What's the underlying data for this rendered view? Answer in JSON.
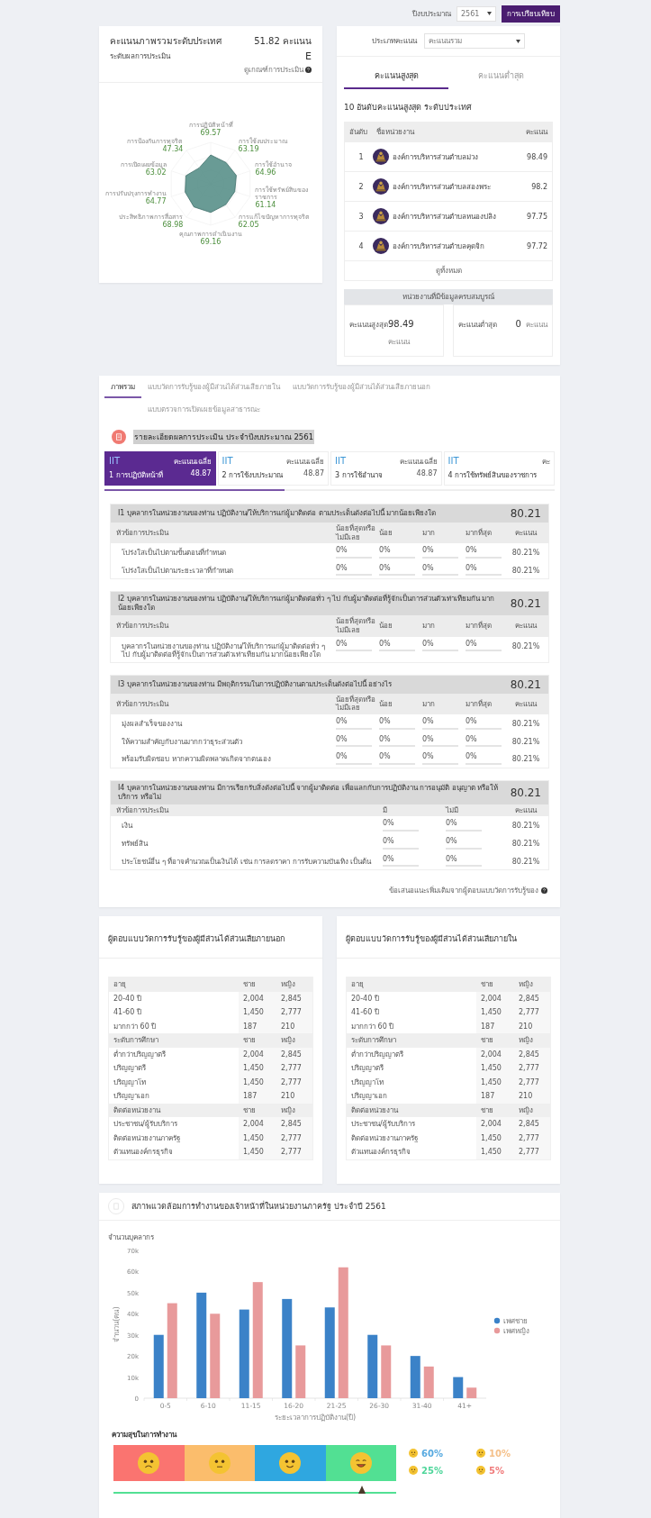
{
  "toolbar": {
    "year_label": "ปีงบประมาณ",
    "year": "2561",
    "compare_button": "การเปรียบเทียบ"
  },
  "overall": {
    "title": "คะแนนภาพรวมระดับประเทศ",
    "score": "51.82 คะแนน",
    "level_label": "ระดับผลการประเมิน",
    "grade": "E",
    "criteria_link": "ดูเกณฑ์การประเมิน",
    "radar": [
      {
        "label": "การปฏิบัติหน้าที่",
        "value": "69.57"
      },
      {
        "label": "การป้องกันการทุจริต",
        "value": "47.34"
      },
      {
        "label": "การใช้งบประมาณ",
        "value": "63.19"
      },
      {
        "label": "การเปิดเผยข้อมูล",
        "value": "63.02"
      },
      {
        "label": "การใช้อำนาจ",
        "value": "64.96"
      },
      {
        "label": "การปรับปรุงการทำงาน",
        "value": "64.77"
      },
      {
        "label": "การใช้ทรัพย์สินของราชการ",
        "value": "61.14"
      },
      {
        "label": "ประสิทธิภาพการสื่อสาร",
        "value": "68.98"
      },
      {
        "label": "การแก้ไขปัญหาการทุจริต",
        "value": "62.05"
      },
      {
        "label": "คุณภาพการดำเนินงาน",
        "value": "69.16"
      }
    ]
  },
  "ranking": {
    "type_label": "ประเภทคะแนน",
    "type_value": "คะแนนรวม",
    "tabs": [
      {
        "label": "คะแนนสูงสุด",
        "selected": true
      },
      {
        "label": "คะแนนต่ำสุด",
        "selected": false
      }
    ],
    "heading": "10 อันดับคะแนนสูงสุด ระดับประเทศ",
    "columns": [
      "อันดับ",
      "ชื่อหน่วยงาน",
      "คะแนน"
    ],
    "rows": [
      {
        "rank": "1",
        "name": "องค์การบริหารส่วนตำบลม่วง",
        "score": "98.49"
      },
      {
        "rank": "2",
        "name": "องค์การบริหารส่วนตำบลสองพระ",
        "score": "98.2"
      },
      {
        "rank": "3",
        "name": "องค์การบริหารส่วนตำบลหนองปลิง",
        "score": "97.75"
      },
      {
        "rank": "4",
        "name": "องค์การบริหารส่วนตำบลคุดจิก",
        "score": "97.72"
      }
    ],
    "view_all": "ดูทั้งหมด",
    "complete_title": "หน่วยงานที่มีข้อมูลครบสมบูรณ์",
    "summary": [
      {
        "label": "คะแนนสูงสุด",
        "value": "98.49",
        "unit": "คะแนน"
      },
      {
        "label": "คะแนนต่ำสุด",
        "value": "0",
        "unit": "คะแนน"
      }
    ]
  },
  "details": {
    "tabs": [
      {
        "label": "ภาพรวม",
        "selected": true
      },
      {
        "label": "แบบวัดการรับรู้ของผู้มีส่วนได้ส่วนเสียภายใน",
        "selected": false
      },
      {
        "label": "แบบวัดการรับรู้ของผู้มีส่วนได้ส่วนเสียภายนอก",
        "selected": false
      },
      {
        "label": "แบบตรวจการเปิดเผยข้อมูลสาธารณะ",
        "selected": false
      }
    ],
    "title": "รายละเอียดผลการประเมิน ประจำปีงบประมาณ 2561",
    "indicators": [
      {
        "tag": "IIT",
        "avg_label": "คะแนนเฉลี่ย",
        "name": "1 การปฏิบัติหน้าที่",
        "score": "48.87",
        "selected": true
      },
      {
        "tag": "IIT",
        "avg_label": "คะแนนเฉลี่ย",
        "name": "2 การใช้งบประมาณ",
        "score": "48.87",
        "selected": false
      },
      {
        "tag": "IIT",
        "avg_label": "คะแนนเฉลี่ย",
        "name": "3 การใช้อำนาจ",
        "score": "48.87",
        "selected": false
      },
      {
        "tag": "IIT",
        "avg_label": "คะ",
        "name": "4 การใช้ทรัพย์สินของราชการ",
        "selected": false
      }
    ],
    "questions": [
      {
        "title": "I1 บุคลากรในหน่วยงานของท่าน ปฏิบัติงาน/ให้บริการแก่ผู้มาติดต่อ ตามประเด็นดังต่อไปนี้ มากน้อยเพียงใด",
        "score": "80.21",
        "columns": [
          "หัวข้อการประเมิน",
          "น้อยที่สุดหรือไม่มีเลย",
          "น้อย",
          "มาก",
          "มากที่สุด",
          "คะแนน"
        ],
        "rows": [
          {
            "topic": "โปร่งใสเป็นไปตามขั้นตอนที่กำหนด",
            "answers": [
              {
                "text": "0%",
                "level": 0
              },
              {
                "text": "0%",
                "level": 0
              },
              {
                "text": "0%",
                "level": 0
              },
              {
                "text": "0%",
                "level": 0
              }
            ],
            "score": "80.21%"
          },
          {
            "topic": "โปร่งใสเป็นไปตามระยะเวลาที่กำหนด",
            "answers": [
              {
                "text": "0%",
                "level": 0
              },
              {
                "text": "0%",
                "level": 0
              },
              {
                "text": "0%",
                "level": 0
              },
              {
                "text": "0%",
                "level": 0
              }
            ],
            "score": "80.21%"
          }
        ]
      },
      {
        "title": "I2 บุคลากรในหน่วยงานของท่าน ปฏิบัติงาน/ให้บริการแก่ผู้มาติดต่อทั่ว ๆ ไป กับผู้มาติดต่อที่รู้จักเป็นการส่วนตัวเท่าเทียมกัน มากน้อยเพียงใด",
        "score": "80.21",
        "columns": [
          "หัวข้อการประเมิน",
          "น้อยที่สุดหรือไม่มีเลย",
          "น้อย",
          "มาก",
          "มากที่สุด",
          "คะแนน"
        ],
        "rows": [
          {
            "topic": "บุคลากรในหน่วยงานของท่าน ปฏิบัติงาน/ให้บริการแก่ผู้มาติดต่อทั่ว ๆ ไป กับผู้มาติดต่อที่รู้จักเป็นการส่วนตัวเท่าเทียมกัน มากน้อยเพียงใด",
            "answers": [
              {
                "text": "0%",
                "level": 0
              },
              {
                "text": "0%",
                "level": 0
              },
              {
                "text": "0%",
                "level": 0
              },
              {
                "text": "0%",
                "level": 0
              }
            ],
            "score": "80.21%"
          }
        ]
      },
      {
        "title": "I3 บุคลากรในหน่วยงานของท่าน มีพฤติกรรมในการปฏิบัติงานตามประเด็นดังต่อไปนี้ อย่างไร",
        "score": "80.21",
        "columns": [
          "หัวข้อการประเมิน",
          "น้อยที่สุดหรือไม่มีเลย",
          "น้อย",
          "มาก",
          "มากที่สุด",
          "คะแนน"
        ],
        "rows": [
          {
            "topic": "มุ่งผลสำเร็จของงาน",
            "answers": [
              {
                "text": "0%",
                "level": 0
              },
              {
                "text": "0%",
                "level": 0
              },
              {
                "text": "0%",
                "level": 0
              },
              {
                "text": "0%",
                "level": 0
              }
            ],
            "score": "80.21%"
          },
          {
            "topic": "ให้ความสำคัญกับงานมากกว่าธุระส่วนตัว",
            "answers": [
              {
                "text": "0%",
                "level": 0
              },
              {
                "text": "0%",
                "level": 0
              },
              {
                "text": "0%",
                "level": 0
              },
              {
                "text": "0%",
                "level": 0
              }
            ],
            "score": "80.21%"
          },
          {
            "topic": "พร้อมรับผิดชอบ หากความผิดพลาดเกิดจากตนเอง",
            "answers": [
              {
                "text": "0%",
                "level": 0
              },
              {
                "text": "0%",
                "level": 0
              },
              {
                "text": "0%",
                "level": 0
              },
              {
                "text": "0%",
                "level": 0
              }
            ],
            "score": "80.21%"
          }
        ]
      },
      {
        "title": "I4 บุคลากรในหน่วยงานของท่าน มีการเรียกรับสิ่งดังต่อไปนี้ จากผู้มาติดต่อ เพื่อแลกกับการปฏิบัติงาน การอนุมัติ อนุญาต หรือให้บริการ หรือไม่",
        "score": "80.21",
        "columns": [
          "หัวข้อการประเมิน",
          "มี",
          "ไม่มี",
          "คะแนน"
        ],
        "rows": [
          {
            "topic": "เงิน",
            "answers": [
              {
                "text": "0%",
                "level": 0
              },
              {
                "text": "0%",
                "level": 0
              }
            ],
            "score": "80.21%"
          },
          {
            "topic": "ทรัพย์สิน",
            "answers": [
              {
                "text": "0%",
                "level": 0
              },
              {
                "text": "0%",
                "level": 0
              }
            ],
            "score": "80.21%"
          },
          {
            "topic": "ประโยชน์อื่น ๆ ที่อาจคำนวณเป็นเงินได้ เช่น การลดราคา การรับความบันเทิง เป็นต้น",
            "answers": [
              {
                "text": "0%",
                "level": 0
              },
              {
                "text": "0%",
                "level": 0
              }
            ],
            "score": "80.21%"
          }
        ]
      }
    ],
    "footnote": "ข้อเสนอแนะเพิ่มเติมจากผู้ตอบแบบวัดการรับรู้ของ"
  },
  "respondents": [
    {
      "title": "ผู้ตอบแบบวัดการรับรู้ของผู้มีส่วนได้ส่วนเสียภายนอก",
      "groups": [
        {
          "heading": [
            "อายุ",
            "ชาย",
            "หญิง"
          ],
          "rows": [
            [
              "20-40 ปี",
              "2,004",
              "2,845"
            ],
            [
              "41-60 ปี",
              "1,450",
              "2,777"
            ],
            [
              "มากกว่า 60 ปี",
              "187",
              "210"
            ]
          ]
        },
        {
          "heading": [
            "ระดับการศึกษา",
            "ชาย",
            "หญิง"
          ],
          "rows": [
            [
              "ต่ำกว่าปริญญาตรี",
              "2,004",
              "2,845"
            ],
            [
              "ปริญญาตรี",
              "1,450",
              "2,777"
            ],
            [
              "ปริญญาโท",
              "1,450",
              "2,777"
            ],
            [
              "ปริญญาเอก",
              "187",
              "210"
            ]
          ]
        },
        {
          "heading": [
            "ติดต่อหน่วยงาน",
            "ชาย",
            "หญิง"
          ],
          "rows": [
            [
              "ประชาชน/ผู้รับบริการ",
              "2,004",
              "2,845"
            ],
            [
              "ติดต่อหน่วยงานภาครัฐ",
              "1,450",
              "2,777"
            ],
            [
              "ตัวแทนองค์กรธุรกิจ",
              "1,450",
              "2,777"
            ]
          ]
        }
      ]
    },
    {
      "title": "ผู้ตอบแบบวัดการรับรู้ของผู้มีส่วนได้ส่วนเสียภายใน",
      "groups": [
        {
          "heading": [
            "อายุ",
            "ชาย",
            "หญิง"
          ],
          "rows": [
            [
              "20-40 ปี",
              "2,004",
              "2,845"
            ],
            [
              "41-60 ปี",
              "1,450",
              "2,777"
            ],
            [
              "มากกว่า 60 ปี",
              "187",
              "210"
            ]
          ]
        },
        {
          "heading": [
            "ระดับการศึกษา",
            "ชาย",
            "หญิง"
          ],
          "rows": [
            [
              "ต่ำกว่าปริญญาตรี",
              "2,004",
              "2,845"
            ],
            [
              "ปริญญาตรี",
              "1,450",
              "2,777"
            ],
            [
              "ปริญญาโท",
              "1,450",
              "2,777"
            ],
            [
              "ปริญญาเอก",
              "187",
              "210"
            ]
          ]
        },
        {
          "heading": [
            "ติดต่อหน่วยงาน",
            "ชาย",
            "หญิง"
          ],
          "rows": [
            [
              "ประชาชน/ผู้รับบริการ",
              "2,004",
              "2,845"
            ],
            [
              "ติดต่อหน่วยงานภาครัฐ",
              "1,450",
              "2,777"
            ],
            [
              "ตัวแทนองค์กรธุรกิจ",
              "1,450",
              "2,777"
            ]
          ]
        }
      ]
    }
  ],
  "environment": {
    "title": "สภาพแวดล้อมการทำงานของเจ้าหน้าที่ในหน่วยงานภาครัฐ ประจำปี 2561",
    "chart_data": {
      "type": "bar",
      "title": "จำนวนบุคลากร",
      "xlabel": "ระยะเวลาการปฏิบัติงาน(ปี)",
      "ylabel": "จำนวน(คน)",
      "categories": [
        "0-5",
        "6-10",
        "11-15",
        "16-20",
        "21-25",
        "26-30",
        "31-40",
        "41+"
      ],
      "series": [
        {
          "name": "เพศชาย",
          "color": "#3b82c8",
          "values": [
            30000,
            50000,
            42000,
            47000,
            43000,
            30000,
            20000,
            10000
          ]
        },
        {
          "name": "เพศหญิง",
          "color": "#e89a9b",
          "values": [
            45000,
            40000,
            55000,
            25000,
            62000,
            25000,
            15000,
            5000
          ]
        }
      ],
      "ylim": [
        0,
        70000
      ],
      "legend": true,
      "yticks": [
        {
          "value": 0,
          "label": "0"
        },
        {
          "value": 10000,
          "label": "10k"
        },
        {
          "value": 20000,
          "label": "20k"
        },
        {
          "value": 30000,
          "label": "30k"
        },
        {
          "value": 40000,
          "label": "40k"
        },
        {
          "value": 50000,
          "label": "50k"
        },
        {
          "value": 60000,
          "label": "60k"
        },
        {
          "value": 70000,
          "label": "70k"
        }
      ]
    },
    "happiness": {
      "title": "ความสุขในการทำงาน",
      "level": 0.88,
      "segments": [
        {
          "kind": "sad",
          "color": "#fa7470"
        },
        {
          "kind": "flat",
          "color": "#fbbd6c"
        },
        {
          "kind": "smile",
          "color": "#2fa7e0"
        },
        {
          "kind": "happy",
          "color": "#52e093"
        }
      ],
      "legend": [
        {
          "kind": "sad",
          "value": "60%",
          "color": "#56a9e0"
        },
        {
          "kind": "flat",
          "value": "10%",
          "color": "#f5c08a"
        },
        {
          "kind": "flat",
          "value": "25%",
          "color": "#4fd69b"
        },
        {
          "kind": "sad",
          "value": "5%",
          "color": "#f07c7c"
        }
      ]
    }
  }
}
